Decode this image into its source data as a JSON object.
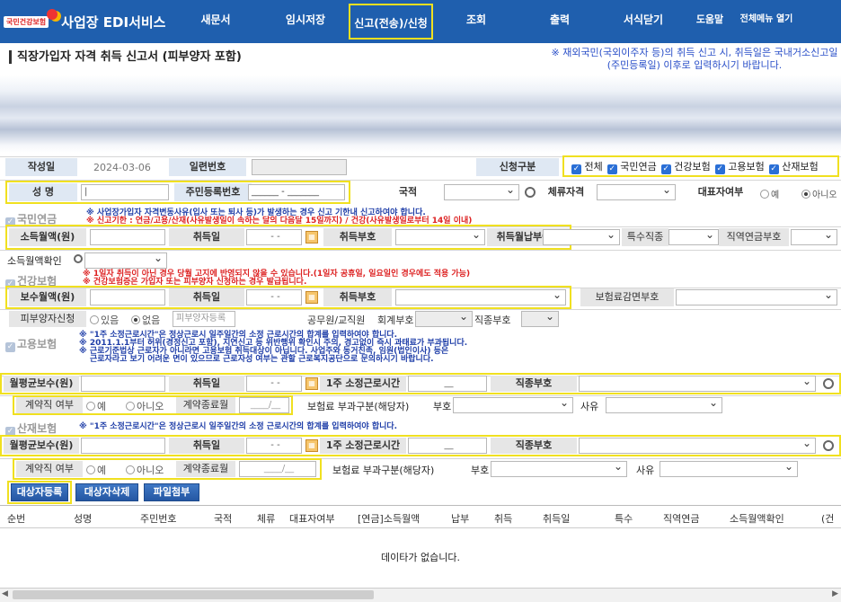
{
  "nav": {
    "logo_badge": "국민건강보험",
    "app_title": "사업장 EDI서비스",
    "items": [
      "새문서",
      "임시저장",
      "신고(전송)/신청",
      "조회",
      "출력",
      "서식닫기",
      "도움말",
      "전체메뉴 열기"
    ]
  },
  "page_title": "직장가입자 자격 취득 신고서 (피부양자 포함)",
  "notice": "※ 재외국민(국외이주자 등)의 취득 신고 시, 취득일은 국내거소신고일(주민등록일) 이후로 입력하시기 바랍니다.",
  "form": {
    "write_date_label": "작성일",
    "write_date": "2024-03-06",
    "serial_label": "일련번호",
    "apply_label": "신청구분",
    "apply_checks": [
      "전체",
      "국민연금",
      "건강보험",
      "고용보험",
      "산재보험"
    ],
    "name_label": "성 명",
    "rrn_label": "주민등록번호",
    "rrn_placeholder": "______ - _______",
    "nation_label": "국적",
    "stay_label": "체류자격",
    "rep_label": "대표자여부",
    "rep_yes": "예",
    "rep_no": "아니오"
  },
  "pension": {
    "section": "국민연금",
    "note1": "※ 사업장가입자 자격변동사유(입사 또는 퇴사 등)가 발생하는 경우 신고 기한내 신고하여야 합니다.",
    "note2": "※ 신고기한 : 연금/고용/산재(사유발생일이 속하는 달의 다음달 15일까지) / 건강(사유발생일로부터 14일 이내)",
    "income_label": "소득월액(원)",
    "acq_date_label": "취득일",
    "date_ph": "- -",
    "acq_code_label": "취득부호",
    "pay_label": "취득월납부여부",
    "special_label": "특수직종",
    "pension_code_label": "직역연금부호",
    "income_check_label": "소득월액확인"
  },
  "health": {
    "section": "건강보험",
    "note1": "※ 1일자 취득이 아닌 경우 당월 고지에 반영되지 않을 수 있습니다.(1일자 공휴일, 일요일인 경우에도 적용 가능)",
    "note2": "※ 건강보험증은 가입자 또는 피부양자 신청하는 경우 발급됩니다.",
    "pay_label": "보수월액(원)",
    "acq_date_label": "취득일",
    "acq_code_label": "취득부호",
    "reduce_label": "보험료감면부호",
    "dep_label": "피부양자신청",
    "dep_yes": "있음",
    "dep_no": "없음",
    "dep_btn": "피부양자등록",
    "official_label": "공무원/교직원",
    "account_label": "회계부호",
    "job_label": "직종부호"
  },
  "employment": {
    "section": "고용보험",
    "notes": [
      "※ \"1주 소정근로시간\"은 정상근로시 일주일간의 소정 근로시간의 합계를 입력하여야 합니다.",
      "※ 2011.1.1부터 허위(경정신고 포함), 지연신고 등 위반행위 확인시 주의, 경고없이 즉시 과태료가 부과됩니다.",
      "※ 근로기준법상 근로자가 아니라면 고용보험 취득대상이 아닙니다. 사업주와 동거친족, 임원(법인이사) 등은",
      "근로자라고 보기 어려운 면이 있으므로 근로자성 여부는 관할 근로복지공단으로 문의하시기 바랍니다."
    ],
    "avg_label": "월평균보수(원)",
    "acq_date_label": "취득일",
    "hours_label": "1주 소정근로시간",
    "hours_ph": "__",
    "job_label": "직종부호",
    "contract_label": "계약직 여부",
    "yes": "예",
    "no": "아니오",
    "end_label": "계약종료월",
    "end_ph": "____/__",
    "levy_label": "보험료 부과구분(해당자)",
    "code_label": "부호",
    "reason_label": "사유"
  },
  "industrial": {
    "section": "산재보험",
    "note": "※ \"1주 소정근로시간\"은 정상근로시 일주일간의 소정 근로시간의 합계를 입력하여야 합니다.",
    "avg_label": "월평균보수(원)",
    "acq_date_label": "취득일",
    "hours_label": "1주 소정근로시간",
    "hours_ph": "__",
    "job_label": "직종부호",
    "contract_label": "계약직 여부",
    "yes": "예",
    "no": "아니오",
    "end_label": "계약종료월",
    "end_ph": "____/__",
    "levy_label": "보험료 부과구분(해당자)",
    "code_label": "부호",
    "reason_label": "사유"
  },
  "buttons": {
    "register": "대상자등록",
    "delete": "대상자삭제",
    "attach": "파일첨부"
  },
  "table": {
    "columns": [
      "순번",
      "성명",
      "주민번호",
      "국적",
      "체류",
      "대표자여부",
      "[연금]소득월액",
      "납부",
      "취득",
      "취득일",
      "특수",
      "직역연금",
      "소득월액확인",
      "(건"
    ],
    "empty": "데이타가 없습니다."
  }
}
